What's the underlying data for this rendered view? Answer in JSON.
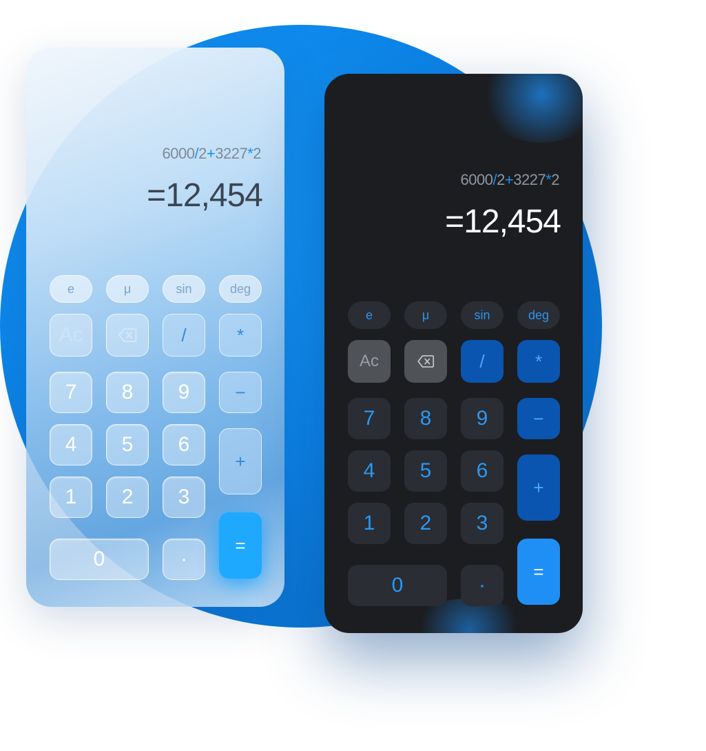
{
  "calculators": [
    {
      "theme": "light",
      "expression": {
        "n1": "6000",
        "op1": "/",
        "n2": "2",
        "op2": "+",
        "n3": "3227",
        "op3": "*",
        "n4": "2"
      },
      "result": "=12,454",
      "sci_keys": [
        "e",
        "μ",
        "sin",
        "deg"
      ],
      "keys": {
        "clear": "Ac",
        "backspace_icon": "backspace-icon",
        "divide": "/",
        "multiply": "*",
        "seven": "7",
        "eight": "8",
        "nine": "9",
        "minus": "−",
        "four": "4",
        "five": "5",
        "six": "6",
        "plus": "+",
        "one": "1",
        "two": "2",
        "three": "3",
        "zero": "0",
        "dot": "·",
        "equals": "="
      }
    },
    {
      "theme": "dark",
      "expression": {
        "n1": "6000",
        "op1": "/",
        "n2": "2",
        "op2": "+",
        "n3": "3227",
        "op3": "*",
        "n4": "2"
      },
      "result": "=12,454",
      "sci_keys": [
        "e",
        "μ",
        "sin",
        "deg"
      ],
      "keys": {
        "clear": "Ac",
        "backspace_icon": "backspace-icon",
        "divide": "/",
        "multiply": "*",
        "seven": "7",
        "eight": "8",
        "nine": "9",
        "minus": "−",
        "four": "4",
        "five": "5",
        "six": "6",
        "plus": "+",
        "one": "1",
        "two": "2",
        "three": "3",
        "zero": "0",
        "dot": "·",
        "equals": "="
      }
    }
  ],
  "colors": {
    "accent": "#1c8ff0",
    "background_circle": "#0c84e8",
    "dark_panel": "#1b1d21",
    "equals_light": "#1ea9ff",
    "equals_dark": "#1f8ff5"
  }
}
